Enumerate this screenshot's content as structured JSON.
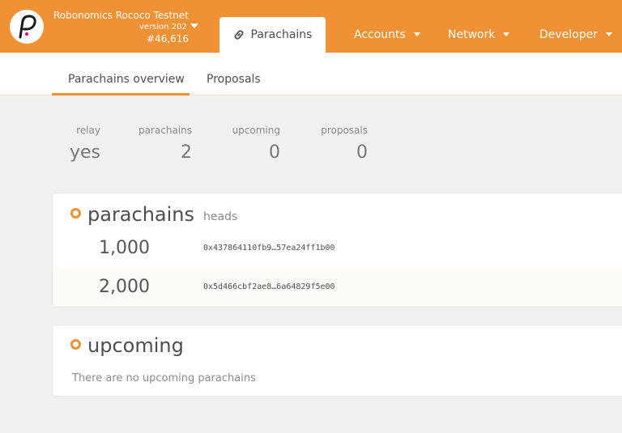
{
  "header": {
    "chain_name": "Robonomics Rococo Testnet",
    "version": "version 202",
    "block": "#46,616",
    "active_tab": {
      "icon": "link-icon",
      "label": "Parachains"
    },
    "nav": [
      {
        "label": "Accounts"
      },
      {
        "label": "Network"
      },
      {
        "label": "Developer"
      }
    ],
    "accent": "#f19135"
  },
  "subnav": {
    "tabs": [
      {
        "label": "Parachains overview",
        "active": true
      },
      {
        "label": "Proposals",
        "active": false
      }
    ]
  },
  "summary": [
    {
      "label": "relay",
      "value": "yes"
    },
    {
      "label": "parachains",
      "value": "2"
    },
    {
      "label": "upcoming",
      "value": "0"
    },
    {
      "label": "proposals",
      "value": "0"
    }
  ],
  "parachains_card": {
    "title": "parachains",
    "heads_label": "heads",
    "rows": [
      {
        "id": "1,000",
        "head": "0x437864110fb9…57ea24ff1b00"
      },
      {
        "id": "2,000",
        "head": "0x5d466cbf2ae8…6a64829f5e00"
      }
    ]
  },
  "upcoming_card": {
    "title": "upcoming",
    "empty_message": "There are no upcoming parachains"
  }
}
